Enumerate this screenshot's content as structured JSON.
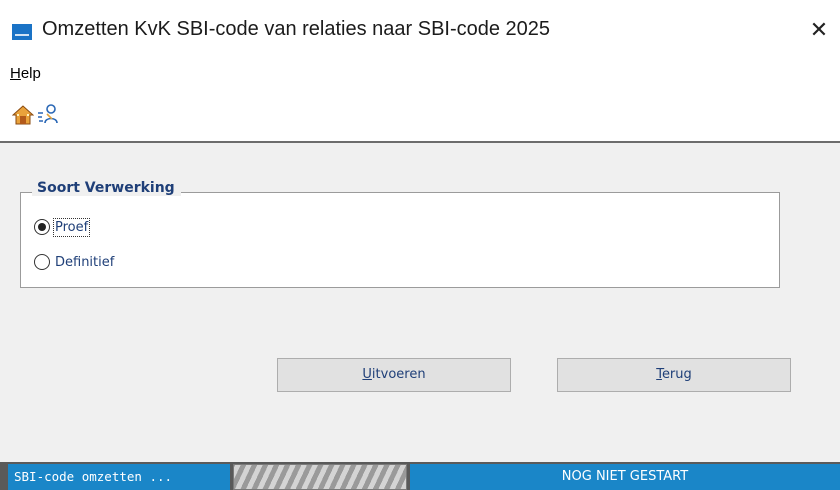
{
  "window": {
    "title": "Omzetten KvK SBI-code van relaties naar SBI-code 2025",
    "close_icon": "close-icon"
  },
  "menu": {
    "help_accel": "H",
    "help_rest": "elp"
  },
  "toolbar": {
    "icons": [
      "home-icon",
      "process-person-icon"
    ]
  },
  "group": {
    "legend": "Soort Verwerking",
    "options": [
      {
        "label": "Proef",
        "checked": true
      },
      {
        "label": "Definitief",
        "checked": false
      }
    ]
  },
  "buttons": {
    "run_accel": "U",
    "run_rest": "itvoeren",
    "back_accel": "T",
    "back_rest": "erug"
  },
  "statusbar": {
    "left_text": "SBI-code omzetten ...",
    "right_text": "NOG NIET GESTART",
    "progress": 0
  },
  "colors": {
    "accent": "#1a86c8",
    "label_text": "#1f3f78"
  }
}
